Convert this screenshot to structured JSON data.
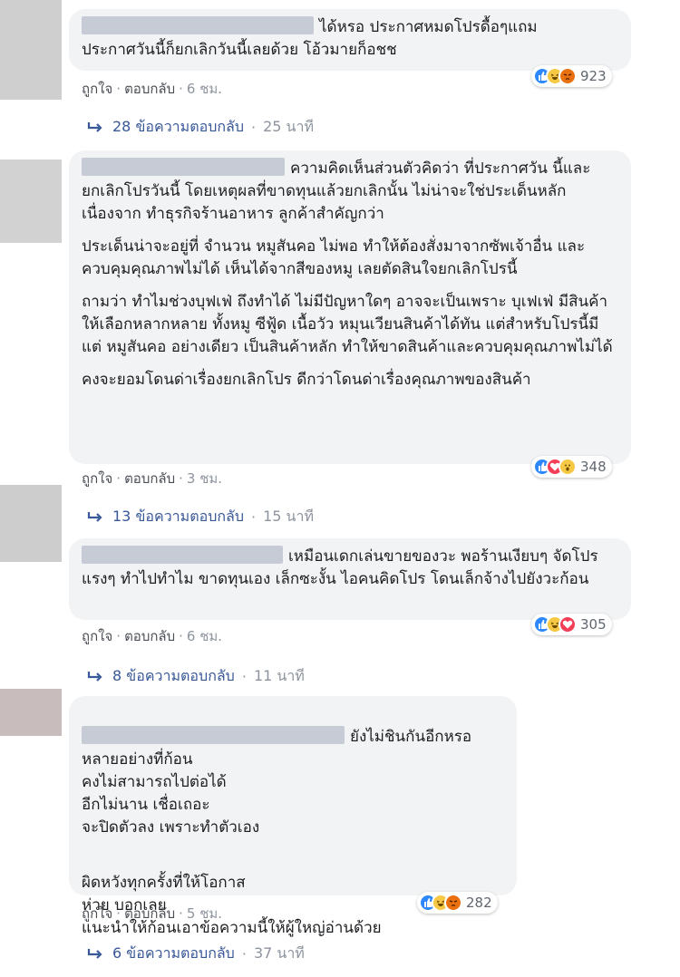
{
  "comments": [
    {
      "paragraphs": [
        "ได้หรอ ประกาศหมดโปรดื้อๆแถม",
        "ประกาศวันนี้ก็ยกเลิกวันนี้เลยด้วย โอ้วมายก็อชช"
      ],
      "like": "ถูกใจ",
      "reply": "ตอบกลับ",
      "time": "6 ชม.",
      "reactions": [
        "like-icon",
        "haha-icon",
        "angry-icon"
      ],
      "reaction_count": "923",
      "replies_label": "28 ข้อความตอบกลับ",
      "replies_time": "25 นาที"
    },
    {
      "paragraphs": [
        "ความคิดเห็นส่วนตัวคิดว่า ที่ประกาศวัน",
        "นี้และยกเลิกโปรวันนี้ โดยเหตุผลที่ขาดทุนแล้วยกเลิกนั้น ไม่น่าจะใช่ประเด็นหลัก เนื่องจาก ทำธุรกิจร้านอาหาร ลูกค้าสำคัญกว่า",
        "ประเด็นน่าจะอยู่ที่ จำนวน หมูสันคอ ไม่พอ ทำให้ต้องสั่งมาจากซัพเจ้าอื่น และควบคุมคุณภาพไม่ได้ เห็นได้จากสีของหมู เลยตัดสินใจยกเลิกโปรนี้",
        "ถามว่า ทำไมช่วงบุฟเฟ่ ถึงทำได้ ไม่มีปัญหาใดๆ อาจจะเป็นเพราะ บุเฟเฟ่ มีสินค้าให้เลือกหลากหลาย ทั้งหมู ซีฟู้ด เนื้อวัว หมุนเวียนสินค้าได้ทัน แต่สำหรับโปรนี้มีแต่ หมูสันคอ อย่างเดียว เป็นสินค้าหลัก ทำให้ขาดสินค้าและควบคุมคุณภาพไม่ได้",
        "คงจะยอมโดนด่าเรื่องยกเลิกโปร ดีกว่าโดนด่าเรื่องคุณภาพของสินค้า"
      ],
      "like": "ถูกใจ",
      "reply": "ตอบกลับ",
      "time": "3 ชม.",
      "reactions": [
        "like-icon",
        "love-icon",
        "wow-icon"
      ],
      "reaction_count": "348",
      "replies_label": "13 ข้อความตอบกลับ",
      "replies_time": "15 นาที"
    },
    {
      "paragraphs": [
        "เหมือนเดกเล่นขายของวะ พอร้านเงียบๆ",
        "จัดโปรแรงๆ ทำไปทำไม ขาดทุนเอง เล็กซะงั้น ไอคนคิดโปร โดนเล็กจ้างไปยังวะก้อน"
      ],
      "like": "ถูกใจ",
      "reply": "ตอบกลับ",
      "time": "6 ชม.",
      "reactions": [
        "like-icon",
        "haha-icon",
        "love-icon"
      ],
      "reaction_count": "305",
      "replies_label": "8 ข้อความตอบกลับ",
      "replies_time": "11 นาที"
    },
    {
      "paragraphs": [
        "ยังไม่ชินกันอีกหรอ",
        "หลายอย่างที่ก้อน\nคงไม่สามารถไปต่อได้\nอีกไม่นาน เชื่อเถอะ\nจะปิดตัวลง เพราะทำตัวเอง",
        "ผิดหวังทุกครั้งที่ให้โอกาส\nห่วย บอกเลย\nแนะนำให้ก้อนเอาข้อความนี้ให้ผู้ใหญ่อ่านด้วย"
      ],
      "like": "ถูกใจ",
      "reply": "ตอบกลับ",
      "time": "5 ชม.",
      "reactions": [
        "like-icon",
        "haha-icon",
        "angry-icon"
      ],
      "reaction_count": "282",
      "replies_label": "6 ข้อความตอบกลับ",
      "replies_time": "37 นาที"
    }
  ],
  "separator": "·"
}
